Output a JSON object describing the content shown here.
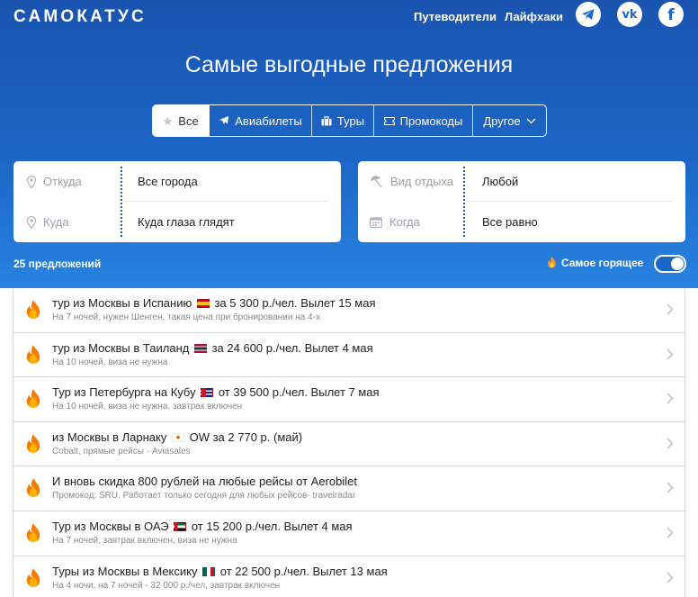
{
  "header": {
    "logo": "САМОКАТУС",
    "nav": [
      "Путеводители",
      "Лайфхаки"
    ],
    "social_icons": [
      "telegram-icon",
      "vk-icon",
      "facebook-icon"
    ],
    "vk_glyph": "vk",
    "fb_glyph": "f"
  },
  "headline": "Самые выгодные предложения",
  "tabs": [
    {
      "label": "Все",
      "icon": "star-icon",
      "active": true
    },
    {
      "label": "Авиабилеты",
      "icon": "plane-icon"
    },
    {
      "label": "Туры",
      "icon": "suitcase-icon"
    },
    {
      "label": "Промокоды",
      "icon": "ticket-icon"
    },
    {
      "label": "Другое",
      "icon": "chevron-down-icon"
    }
  ],
  "search": {
    "from_label": "Откуда",
    "from_value": "Все города",
    "to_label": "Куда",
    "to_value": "Куда глаза глядят",
    "vacation_label": "Вид отдыха",
    "vacation_value": "Любой",
    "when_label": "Когда",
    "when_value": "Все равно"
  },
  "offers_count": "25 предложений",
  "hot_filter": {
    "label": "Самое горящее",
    "on": true
  },
  "colors": {
    "accent": "#1c66c6",
    "flame": "#f57c00"
  },
  "offers": [
    {
      "pre": "тур из Москвы в Испанию",
      "flag": "es",
      "post": "за 5 300 р./чел. Вылет 15 мая",
      "sub": "На 7 ночей, нужен Шенген, такая цена при бронировании на 4-х"
    },
    {
      "pre": "тур из Москвы в Таиланд",
      "flag": "th",
      "post": "за 24 600 р./чел. Вылет 4 мая",
      "sub": "На 10 ночей, виза не нужна"
    },
    {
      "pre": "Тур из Петербурга на Кубу",
      "flag": "cu",
      "post": "от 39 500 р./чел. Вылет 7 мая",
      "sub": "На 10 ночей, виза не нужна, завтрак включен"
    },
    {
      "pre": "из Москвы в Ларнаку",
      "flag": "cy",
      "post": "OW за 2 770 р. (май)",
      "sub": "Cobalt, прямые рейсы - Aviasales"
    },
    {
      "pre": "И вновь скидка 800 рублей на любые рейсы от Aerobilet",
      "flag": "",
      "post": "",
      "sub": "Промокод: SRU. Работает только сегодня для любых рейсов- travelradar"
    },
    {
      "pre": "Тур из Москвы в ОАЭ",
      "flag": "ae",
      "post": "от 15 200 р./чел. Вылет 4 мая",
      "sub": "На 7 ночей, завтрак включен, виза не нужна"
    },
    {
      "pre": "Туры из Москвы в Мексику",
      "flag": "mx",
      "post": "от 22 500 р./чел. Вылет 13 мая",
      "sub": "На 4 ночи, на 7 ночей - 32 000 р./чел, завтрак включен"
    }
  ]
}
